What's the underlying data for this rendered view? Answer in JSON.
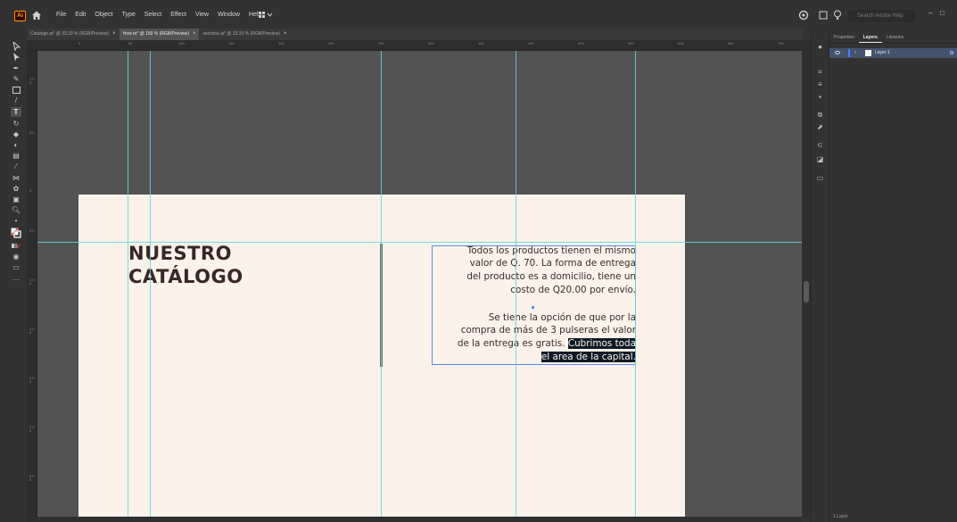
{
  "app": {
    "logo": "Ai"
  },
  "menu": [
    "File",
    "Edit",
    "Object",
    "Type",
    "Select",
    "Effect",
    "View",
    "Window",
    "Help"
  ],
  "search": {
    "placeholder": "Search Adobe Help"
  },
  "tabs": [
    {
      "label": "Catalogo.ai* @ 33.33 % (RGB/Preview)",
      "active": false
    },
    {
      "label": "How to* @ 150 % (RGB/Preview)",
      "active": true
    },
    {
      "label": "sections.ai* @ 33.33 % (RGB/Preview)",
      "active": false
    }
  ],
  "ruler": {
    "top_labels": [
      "0",
      "50",
      "100",
      "150",
      "200",
      "250",
      "300",
      "350",
      "400",
      "450",
      "500",
      "550",
      "600",
      "650",
      "700"
    ],
    "left_labels": [
      "1 0 0",
      "5 0",
      "0",
      "5 0",
      "1 0 0",
      "1 5 0",
      "2 0 0",
      "2 5 0",
      "3 0 0"
    ]
  },
  "artboard": {
    "title_line1": "NUESTRO",
    "title_line2": "CATÁLOGO",
    "para1": [
      "Todos los productos tienen el mismo",
      "valor de Q. 70. La forma de entrega",
      "del producto es a domicilio, tiene un",
      "costo de Q20.00 por envío."
    ],
    "para2_line1": "Se tiene la opción de que por la",
    "para2_line2": "compra de más de 3 pulseras el valor",
    "para2_line3_plain": "de la entrega es gratis. ",
    "para2_line3_selected": "Cubrimos toda",
    "para2_line4_selected": "el area de la capital."
  },
  "panel": {
    "tabs": [
      "Properties",
      "Layers",
      "Libraries"
    ],
    "active_tab": "Layers",
    "layer_name": "Layer 1",
    "footer": "1 Layer"
  },
  "colors": {
    "guide": "#5fd6dd",
    "artboard": "#fbf2ea",
    "selection": "#5c8be8",
    "title": "#3a2626"
  }
}
